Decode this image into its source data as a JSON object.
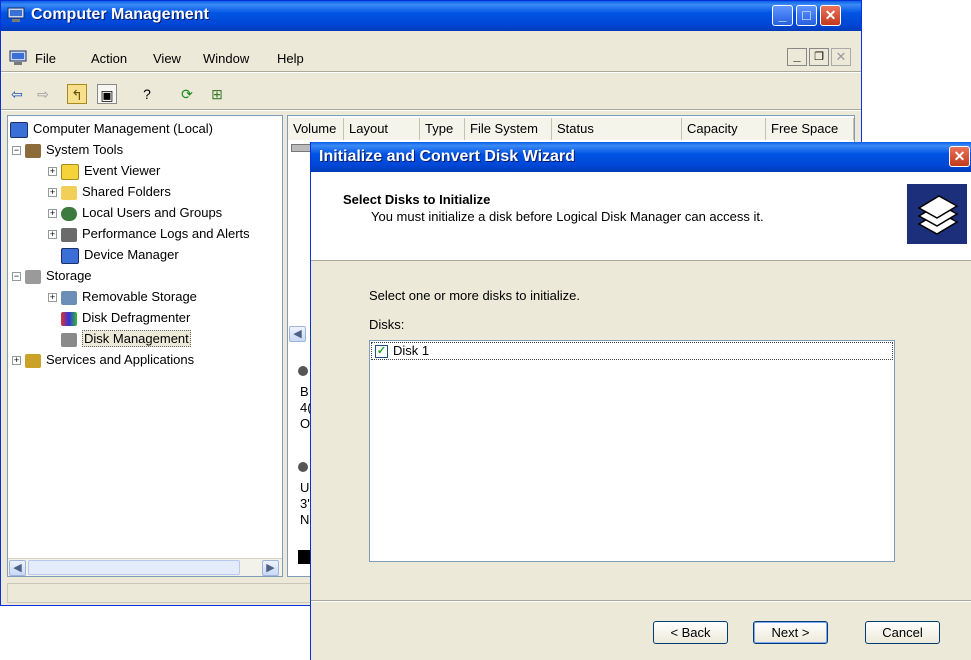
{
  "main_window": {
    "title": "Computer Management",
    "menu": [
      "File",
      "Action",
      "View",
      "Window",
      "Help"
    ],
    "toolbar_icons": [
      "back-icon",
      "forward-icon",
      "up-folder-icon",
      "show-hide-tree-icon",
      "help-icon",
      "refresh-icon",
      "export-icon"
    ],
    "tree": {
      "root": "Computer Management (Local)",
      "system_tools": "System Tools",
      "event_viewer": "Event Viewer",
      "shared_folders": "Shared Folders",
      "local_users": "Local Users and Groups",
      "perf_logs": "Performance Logs and Alerts",
      "device_manager": "Device Manager",
      "storage": "Storage",
      "removable_storage": "Removable Storage",
      "disk_defrag": "Disk Defragmenter",
      "disk_management": "Disk Management",
      "services_apps": "Services and Applications"
    },
    "list_columns": [
      "Volume",
      "Layout",
      "Type",
      "File System",
      "Status",
      "Capacity",
      "Free Space"
    ],
    "partial_disk_text": {
      "disk0": [
        "B",
        "4(",
        "O"
      ],
      "disk1": [
        "U",
        "3'",
        "N"
      ]
    }
  },
  "wizard": {
    "title": "Initialize and Convert Disk Wizard",
    "header_title": "Select Disks to Initialize",
    "header_subtitle": "You must initialize a disk before Logical Disk Manager can access it.",
    "instruction": "Select one or more disks to initialize.",
    "disks_label": "Disks:",
    "disks": [
      {
        "label": "Disk 1",
        "checked": true
      }
    ],
    "buttons": {
      "back": "< Back",
      "next": "Next >",
      "cancel": "Cancel"
    }
  }
}
